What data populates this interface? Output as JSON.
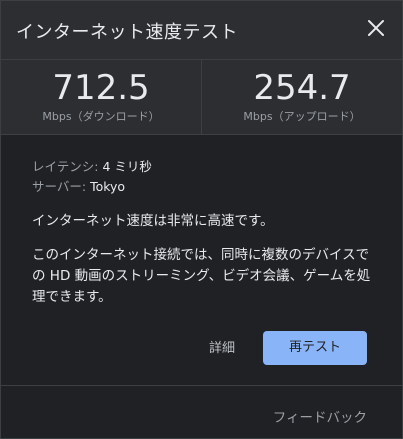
{
  "header": {
    "title": "インターネット速度テスト",
    "close_icon": "close-icon"
  },
  "results": {
    "download": {
      "value": "712.5",
      "unit_label": "Mbps（ダウンロード）"
    },
    "upload": {
      "value": "254.7",
      "unit_label": "Mbps（アップロード）"
    }
  },
  "info": {
    "latency_label": "レイテンシ: ",
    "latency_value": "4 ミリ秒",
    "server_label": "サーバー: ",
    "server_value": "Tokyo",
    "summary": "インターネット速度は非常に高速です。",
    "detail": "このインターネット接続では、同時に複数のデバイスでの HD 動画のストリーミング、ビデオ会議、ゲームを処理できます。"
  },
  "actions": {
    "details_label": "詳細",
    "retest_label": "再テスト"
  },
  "footer": {
    "feedback_label": "フィードバック"
  },
  "colors": {
    "background": "#202124",
    "header_background": "#2d2e31",
    "primary_button": "#8ab4f8",
    "text_primary": "#e8eaed",
    "text_secondary": "#9aa0a6"
  }
}
